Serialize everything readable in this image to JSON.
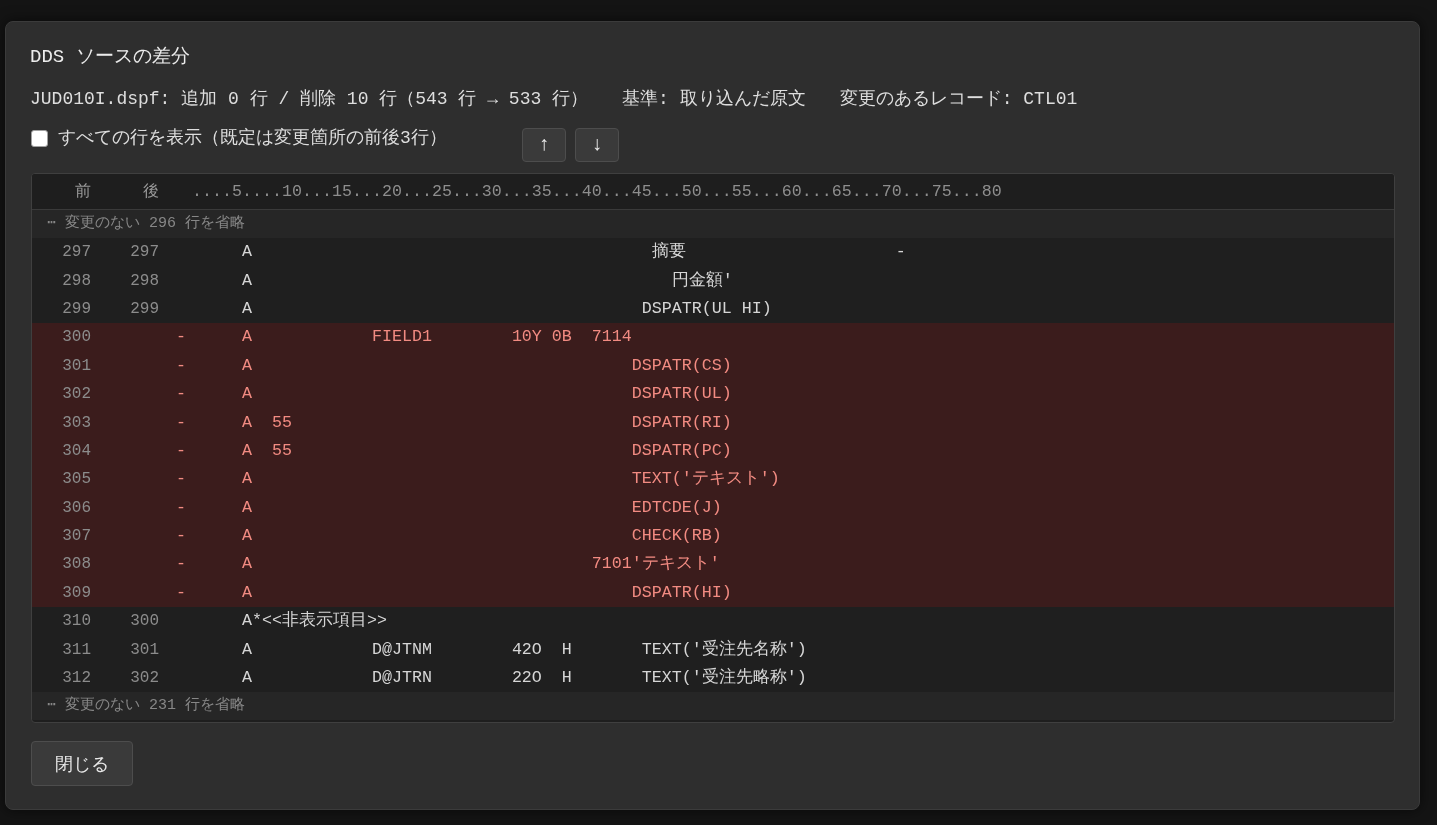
{
  "dialog": {
    "title": "DDS ソースの差分",
    "summary": {
      "counts": "JUD010I.dspf: 追加 0 行 / 削除 10 行（543 行 → 533 行）",
      "baseline": "基準: 取り込んだ原文",
      "changed_records": "変更のあるレコード: CTL01"
    },
    "show_all": {
      "label": "すべての行を表示（既定は変更箇所の前後3行）",
      "checked": false
    },
    "nav_buttons": [
      "↑",
      "↓"
    ],
    "diff": {
      "columns": [
        "前",
        "後"
      ],
      "ruler": "....5....10...15...20...25...30...35...40...45...50...55...60...65...70...75...80",
      "rows": [
        {
          "kind": "gap",
          "text": "⋯ 変更のない 296 行を省略"
        },
        {
          "kind": "same",
          "old": "297",
          "new": "297",
          "code": "A                                        摘要                     -"
        },
        {
          "kind": "same",
          "old": "298",
          "new": "298",
          "code": "A                                          円金額'"
        },
        {
          "kind": "same",
          "old": "299",
          "new": "299",
          "code": "A                                       DSPATR(UL HI)"
        },
        {
          "kind": "removed",
          "old": "300",
          "mark": "-",
          "code": "A            FIELD1        10Y 0B  7114"
        },
        {
          "kind": "removed",
          "old": "301",
          "mark": "-",
          "code": "A                                      DSPATR(CS)"
        },
        {
          "kind": "removed",
          "old": "302",
          "mark": "-",
          "code": "A                                      DSPATR(UL)"
        },
        {
          "kind": "removed",
          "old": "303",
          "mark": "-",
          "code": "A  55                                  DSPATR(RI)"
        },
        {
          "kind": "removed",
          "old": "304",
          "mark": "-",
          "code": "A  55                                  DSPATR(PC)"
        },
        {
          "kind": "removed",
          "old": "305",
          "mark": "-",
          "code": "A                                      TEXT('テキスト')"
        },
        {
          "kind": "removed",
          "old": "306",
          "mark": "-",
          "code": "A                                      EDTCDE(J)"
        },
        {
          "kind": "removed",
          "old": "307",
          "mark": "-",
          "code": "A                                      CHECK(RB)"
        },
        {
          "kind": "removed",
          "old": "308",
          "mark": "-",
          "code": "A                                  7101'テキスト'"
        },
        {
          "kind": "removed",
          "old": "309",
          "mark": "-",
          "code": "A                                      DSPATR(HI)"
        },
        {
          "kind": "same",
          "old": "310",
          "new": "300",
          "code": "A*<<非表示項目>>"
        },
        {
          "kind": "same",
          "old": "311",
          "new": "301",
          "code": "A            D@JTNM        42O  H       TEXT('受注先名称')"
        },
        {
          "kind": "same",
          "old": "312",
          "new": "302",
          "code": "A            D@JTRN        22O  H       TEXT('受注先略称')"
        },
        {
          "kind": "gap",
          "text": "⋯ 変更のない 231 行を省略"
        }
      ]
    },
    "close_button": "閉じる"
  }
}
